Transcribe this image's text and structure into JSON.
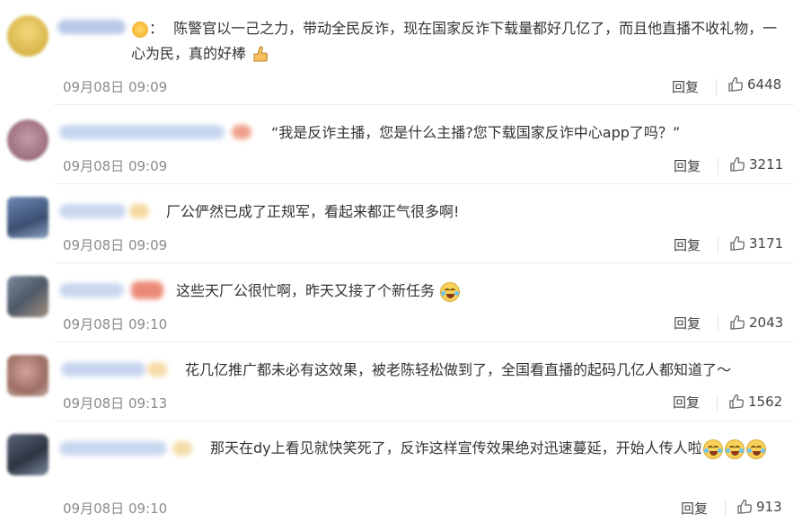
{
  "comments": [
    {
      "text": "陈警官以一己之力，带动全民反诈，现在国家反诈下载量都好几亿了，而且他直播不收礼物，一心为民，真的好棒",
      "time": "09月08日 09:09",
      "reply": "回复",
      "likes": "6448",
      "emoji_after": "thumbs-up",
      "prefix_emoji": "smiling-face",
      "prefix_sep": "："
    },
    {
      "text": "“我是反诈主播，您是什么主播?您下载国家反诈中心app了吗？”",
      "time": "09月08日 09:09",
      "reply": "回复",
      "likes": "3211"
    },
    {
      "text": "厂公俨然已成了正规军，看起来都正气很多啊!",
      "time": "09月08日 09:09",
      "reply": "回复",
      "likes": "3171"
    },
    {
      "text": "这些天厂公很忙啊，昨天又接了个新任务",
      "time": "09月08日 09:10",
      "reply": "回复",
      "likes": "2043",
      "emoji_after": "laughing-tears"
    },
    {
      "text": "花几亿推广都未必有这效果，被老陈轻松做到了，全国看直播的起码几亿人都知道了～",
      "time": "09月08日 09:13",
      "reply": "回复",
      "likes": "1562"
    },
    {
      "text": "那天在dy上看见就快笑死了，反诈这样宣传效果绝对迅速蔓延，开始人传人啦",
      "time": "09月08日 09:10",
      "reply": "回复",
      "likes": "913",
      "emoji_after": "laughing-tears"
    }
  ],
  "colors": {
    "text": "#333333",
    "time": "#8a8a8a",
    "divider": "#ececec",
    "emoji_yellow": "#f7d15a"
  }
}
